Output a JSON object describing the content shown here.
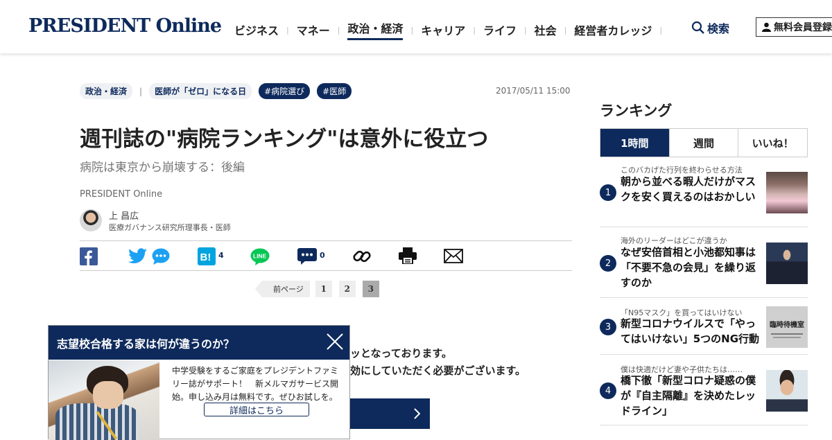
{
  "header": {
    "logo": "PRESIDENT Online",
    "nav": [
      "ビジネス",
      "マネー",
      "政治・経済",
      "キャリア",
      "ライフ",
      "社会",
      "経営者カレッジ"
    ],
    "active_nav": "政治・経済",
    "search_label": "検索",
    "member_label": "無料会員登録"
  },
  "article": {
    "category": "政治・経済",
    "series": "医師が「ゼロ」になる日",
    "hashtags": [
      "#病院選び",
      "#医師"
    ],
    "date": "2017/05/11 15:00",
    "title": "週刊誌の\"病院ランキング\"は意外に役立つ",
    "subtitle": "病院は東京から崩壊する：後編",
    "source": "PRESIDENT Online",
    "author_name": "上 昌広",
    "author_title": "医療ガバナンス研究所理事長・医師",
    "share_counts": {
      "hatena": "4",
      "comments": "0"
    },
    "pager": {
      "prev_label": "前ページ",
      "pages": [
        "1",
        "2",
        "3"
      ],
      "current": "3"
    },
    "body_line1": "ッとなっております。",
    "body_line2": "効にしていただく必要がございます。"
  },
  "popup": {
    "title": "志望校合格する家は何が違うのか？",
    "text": "中学受験をするご家庭をプレジデントファミリー誌がサポート！　新メルマガサービス開始。申し込み月は無料です。ぜひお試しを。",
    "button": "詳細はこちら"
  },
  "ranking": {
    "title": "ランキング",
    "tabs": [
      "1時間",
      "週間",
      "いいね！"
    ],
    "active_tab": "1時間",
    "items": [
      {
        "num": "1",
        "kicker": "このバカげた行列を終わらせる方法",
        "headline": "朝から並べる暇人だけがマスクを安く買えるのはおかしい",
        "thumb": "crowd-photo"
      },
      {
        "num": "2",
        "kicker": "海外のリーダーはどこが違うか",
        "headline": "なぜ安倍首相と小池都知事は「不要不急の会見」を繰り返すのか",
        "thumb": "politician-photo"
      },
      {
        "num": "3",
        "kicker": "「N95マスク」を買ってはいけない",
        "headline": "新型コロナウイルスで「やってはいけない」5つのNG行動",
        "thumb": "notice-photo",
        "thumb_text": "臨時待機室"
      },
      {
        "num": "4",
        "kicker": "僕は快適だけど妻や子供たちは……",
        "headline": "橋下徹「新型コロナ疑惑の僕が『自主隔離』を決めたレッドライン」",
        "thumb": "portrait-photo"
      }
    ]
  },
  "colors": {
    "brand": "#0e2a5c",
    "twitter": "#1da1f2",
    "facebook": "#3b5998",
    "line": "#06c755",
    "hatena": "#00a4de"
  }
}
